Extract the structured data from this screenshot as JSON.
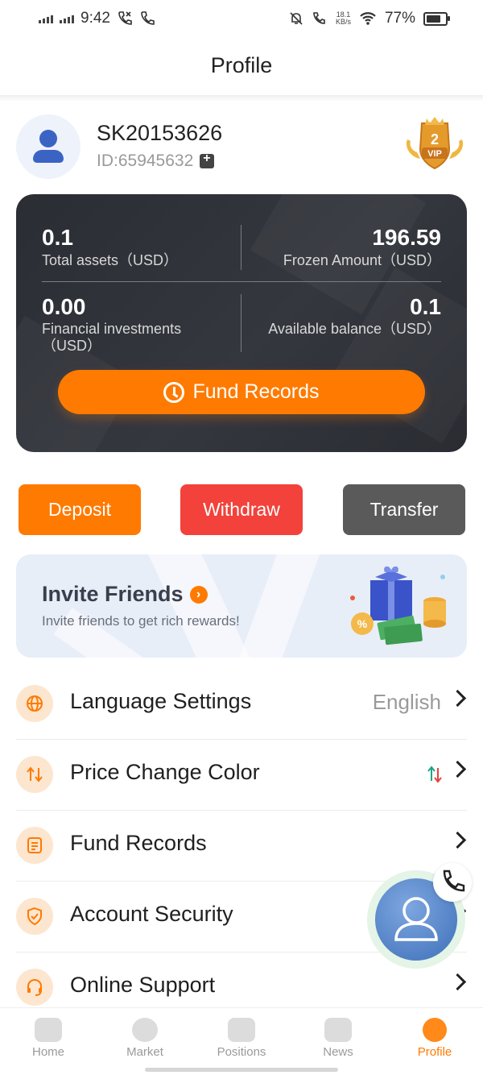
{
  "status_bar": {
    "time": "9:42",
    "net_speed_value": "18.1",
    "net_speed_unit": "KB/s",
    "battery": "77%"
  },
  "header": {
    "title": "Profile"
  },
  "user": {
    "username": "SK20153626",
    "id_text": "ID:65945632",
    "vip_level": "2",
    "vip_label": "VIP"
  },
  "assets": {
    "total_assets": {
      "value": "0.1",
      "label": "Total assets（USD）"
    },
    "frozen_amount": {
      "value": "196.59",
      "label": "Frozen Amount（USD）"
    },
    "financial_investments": {
      "value": "0.00",
      "label_line1": "Financial investments",
      "label_line2": "（USD）"
    },
    "available_balance": {
      "value": "0.1",
      "label": "Available balance（USD）"
    },
    "fund_records_button": "Fund Records"
  },
  "actions": {
    "deposit": "Deposit",
    "withdraw": "Withdraw",
    "transfer": "Transfer"
  },
  "invite": {
    "title": "Invite Friends",
    "subtitle": "Invite friends to get rich rewards!"
  },
  "menu": {
    "language": {
      "label": "Language Settings",
      "value": "English"
    },
    "price_color": {
      "label": "Price Change Color"
    },
    "fund_records": {
      "label": "Fund Records"
    },
    "account_security": {
      "label": "Account Security"
    },
    "online_support": {
      "label": "Online Support"
    }
  },
  "bottom_nav": {
    "home": "Home",
    "market": "Market",
    "positions": "Positions",
    "news": "News",
    "profile": "Profile",
    "active": "profile"
  },
  "colors": {
    "accent": "#ff7a00",
    "withdraw": "#f2423b",
    "transfer": "#5a5a5a",
    "card_bg": "#2f3138"
  },
  "icons": [
    "phone-call-icon",
    "phone-icon",
    "mute-icon",
    "wifi-icon",
    "battery-icon",
    "copy-icon",
    "vip-badge-icon",
    "clock-icon",
    "globe-icon",
    "price-swap-icon",
    "document-icon",
    "shield-check-icon",
    "headset-icon",
    "home-icon",
    "market-icon",
    "positions-icon",
    "news-icon",
    "profile-icon"
  ]
}
